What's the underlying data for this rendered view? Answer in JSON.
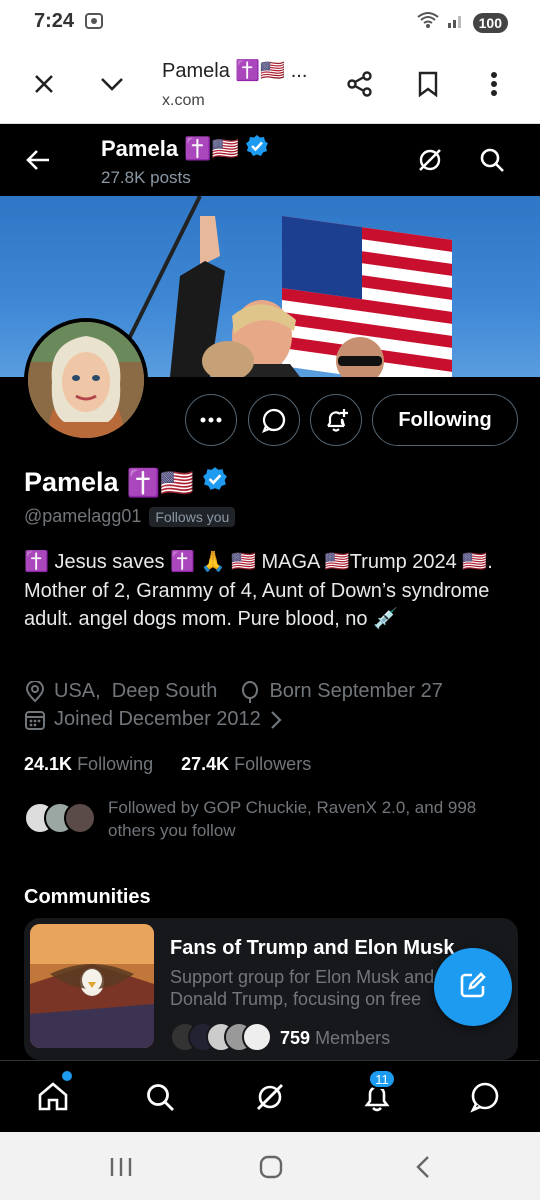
{
  "status_bar": {
    "time": "7:24",
    "battery": "100"
  },
  "browser": {
    "page_title": "Pamela ✝️🇺🇸 ...",
    "url": "x.com"
  },
  "header": {
    "name": "Pamela",
    "emoji": "✝️🇺🇸",
    "posts": "27.8K posts"
  },
  "profile": {
    "name": "Pamela",
    "emoji": "✝️🇺🇸",
    "handle": "@pamelagg01",
    "follows_you": "Follows you",
    "following_button": "Following",
    "bio": "✝️ Jesus saves ✝️ 🙏 🇺🇸 MAGA 🇺🇸Trump 2024 🇺🇸. Mother of 2, Grammy of 4, Aunt of Down’s syndrome adult. angel dogs mom. Pure blood, no 💉",
    "location": "USA,  Deep South",
    "birthday": "Born September 27",
    "joined": "Joined December 2012",
    "following_count": "24.1K",
    "following_label": "Following",
    "followers_count": "27.4K",
    "followers_label": "Followers",
    "followed_by": "Followed by GOP Chuckie, RavenX 2.0, and 998 others you follow"
  },
  "communities": {
    "title": "Communities",
    "card": {
      "name": "Fans of Trump and Elon Musk",
      "description": "Support group for Elon Musk and Donald Trump, focusing on free",
      "members_count": "759",
      "members_label": "Members"
    }
  },
  "bottom_nav": {
    "notifications_badge": "11"
  },
  "colors": {
    "accent": "#1d9bf0",
    "verified": "#1d9bf0",
    "background": "#000000"
  }
}
